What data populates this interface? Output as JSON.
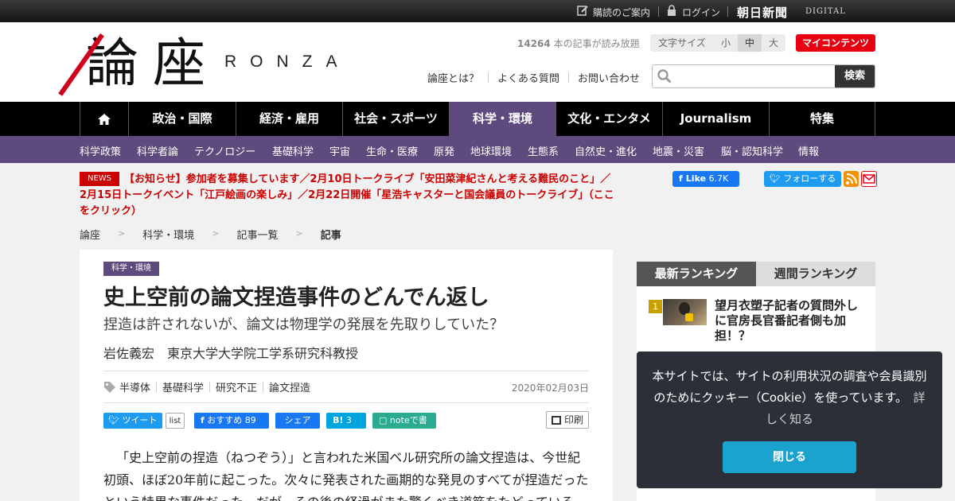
{
  "topbar": {
    "subscribe": "購読のご案内",
    "login": "ログイン",
    "brand": "朝日新聞",
    "brand_sub": "DIGITAL"
  },
  "logo": {
    "kanji1": "論",
    "kanji2": "座",
    "latin": "RONZA"
  },
  "header": {
    "read_count": "14264",
    "read_count_suffix": "本の記事が読み放題",
    "font_size_label": "文字サイズ",
    "font_sizes": [
      "小",
      "中",
      "大"
    ],
    "font_size_selected": "中",
    "my_content": "マイコンテンツ",
    "links": [
      "論座とは？",
      "よくある質問",
      "お問い合わせ"
    ],
    "search_placeholder": "",
    "search_button": "検索"
  },
  "nav": {
    "home_icon": "home-icon",
    "items": [
      "政治・国際",
      "経済・雇用",
      "社会・スポーツ",
      "科学・環境",
      "文化・エンタメ",
      "Journalism",
      "特集"
    ],
    "active": "科学・環境",
    "active_color": "#5e4a7d"
  },
  "subnav": [
    "科学政策",
    "科学者論",
    "テクノロジー",
    "基礎科学",
    "宇宙",
    "生命・医療",
    "原発",
    "地球環境",
    "生態系",
    "自然史・進化",
    "地震・災害",
    "脳・認知科学",
    "情報"
  ],
  "news": {
    "badge": "NEWS",
    "text": "【お知らせ】参加者を募集しています／2月10日トークライブ「安田菜津紀さんと考える難民のこと」／2月15日トークイベント「江戸絵画の楽しみ」／2月22日開催「星浩キャスターと国会議員のトークライブ」（ここをクリック）"
  },
  "social": {
    "fb_like": "Like",
    "fb_count": "6.7K",
    "tw_follow": "フォローする"
  },
  "breadcrumb": [
    "論座",
    "科学・環境",
    "記事一覧",
    "記事"
  ],
  "article": {
    "category": "科学・環境",
    "title": "史上空前の論文捏造事件のどんでん返し",
    "subtitle": "捏造は許されないが、論文は物理学の発展を先取りしていた？",
    "author": "岩佐義宏　東京大学大学院工学系研究科教授",
    "tags": [
      "半導体",
      "基礎科学",
      "研究不正",
      "論文捏造"
    ],
    "date": "2020年02月03日",
    "share": {
      "tweet": "ツイート",
      "list": "list",
      "fb_recommend": "おすすめ",
      "fb_recommend_count": "89",
      "fb_share": "シェア",
      "hatena": "B!",
      "hatena_count": "3",
      "note": "noteで書く",
      "print": "印刷"
    },
    "body": "「史上空前の捏造（ねつぞう）」と言われた米国ベル研究所の論文捏造は、今世紀初頭、ほぼ20年前に起こった。次々に発表された画期的な発見のすべてが捏造だったという特異な事件だった。だが、その後の経過がまた驚くべき道筋をたどっている。"
  },
  "ranking": {
    "tab_latest": "最新ランキング",
    "tab_weekly": "週間ランキング",
    "items": [
      {
        "rank": "1",
        "title": "望月衣塑子記者の質問外しに官房長官番記者側も加担！？"
      }
    ]
  },
  "cookie": {
    "message": "本サイトでは、サイトの利用状況の調査や会員識別のためにクッキー（Cookie）を使っています。",
    "more": "詳しく知る",
    "close": "閉じる"
  }
}
